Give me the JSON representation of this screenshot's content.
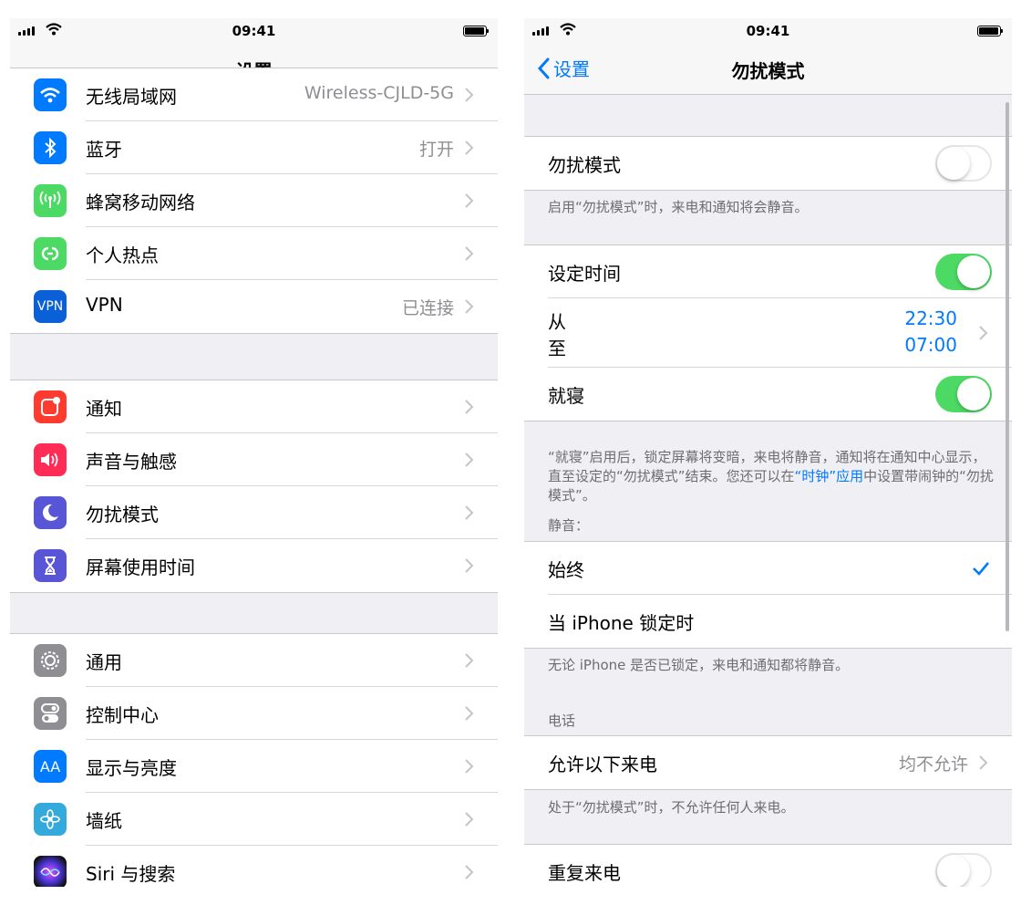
{
  "colors": {
    "accent": "#007aff",
    "switch_on": "#4cd964",
    "separator": "#c8c7cc",
    "background": "#efeff4"
  },
  "left": {
    "status": {
      "time": "09:41"
    },
    "nav": {
      "title": "设置"
    },
    "group1": [
      {
        "icon": "wifi-icon",
        "label": "无线局域网",
        "value": "Wireless-CJLD-5G"
      },
      {
        "icon": "bluetooth-icon",
        "label": "蓝牙",
        "value": "打开"
      },
      {
        "icon": "cellular-icon",
        "label": "蜂窝移动网络",
        "value": ""
      },
      {
        "icon": "hotspot-icon",
        "label": "个人热点",
        "value": ""
      },
      {
        "icon": "vpn-icon",
        "icon_text": "VPN",
        "label": "VPN",
        "value": "已连接"
      }
    ],
    "group2": [
      {
        "icon": "notifications-icon",
        "label": "通知"
      },
      {
        "icon": "sounds-icon",
        "label": "声音与触感"
      },
      {
        "icon": "moon-icon",
        "label": "勿扰模式"
      },
      {
        "icon": "screen-time-icon",
        "label": "屏幕使用时间"
      }
    ],
    "group3": [
      {
        "icon": "gear-icon",
        "label": "通用"
      },
      {
        "icon": "control-center-icon",
        "label": "控制中心"
      },
      {
        "icon": "display-icon",
        "icon_text": "AA",
        "label": "显示与亮度"
      },
      {
        "icon": "wallpaper-icon",
        "label": "墙纸"
      },
      {
        "icon": "siri-icon",
        "label": "Siri 与搜索"
      }
    ]
  },
  "right": {
    "status": {
      "time": "09:41"
    },
    "nav": {
      "back_label": "设置",
      "title": "勿扰模式"
    },
    "dnd": {
      "label": "勿扰模式",
      "enabled": false,
      "footer": "启用“勿扰模式”时，来电和通知将会静音。"
    },
    "scheduled": {
      "label": "设定时间",
      "enabled": true,
      "from_label": "从",
      "to_label": "至",
      "from_time": "22:30",
      "to_time": "07:00"
    },
    "bedtime": {
      "label": "就寝",
      "enabled": true,
      "footer_part1": "“就寝”启用后，锁定屏幕将变暗，来电将静音，通知将在通知中心显示，直至设定的“勿扰模式”结束。您还可以在",
      "footer_link": "“时钟”应用",
      "footer_part2": "中设置带闹钟的“勿扰模式”。"
    },
    "silence": {
      "header": "静音：",
      "options": [
        {
          "label": "始终",
          "selected": true
        },
        {
          "label": "当 iPhone 锁定时",
          "selected": false
        }
      ],
      "footer": "无论 iPhone 是否已锁定，来电和通知都将静音。"
    },
    "phone": {
      "header": "电话",
      "allow_label": "允许以下来电",
      "allow_value": "均不允许",
      "footer": "处于“勿扰模式”时，不允许任何人来电。",
      "repeated_label": "重复来电",
      "repeated_enabled": false
    }
  }
}
